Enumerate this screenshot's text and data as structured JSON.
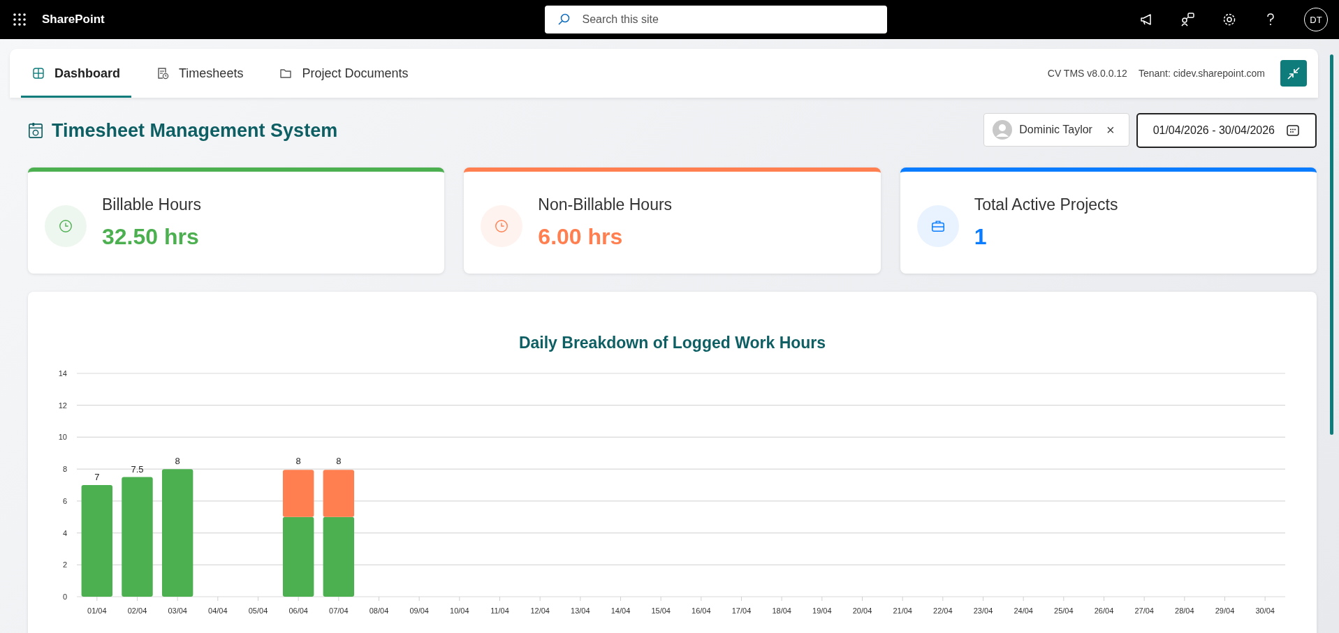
{
  "top_bar": {
    "app_name": "SharePoint",
    "search": {
      "placeholder": "Search this site"
    },
    "avatar_initials": "DT"
  },
  "tabs": [
    {
      "label": "Dashboard",
      "selected": true
    },
    {
      "label": "Timesheets",
      "selected": false
    },
    {
      "label": "Project Documents",
      "selected": false
    }
  ],
  "version": "CV TMS v8.0.0.12",
  "tenant": "Tenant: cidev.sharepoint.com",
  "page_title": "Timesheet Management System",
  "user_filter": {
    "name": "Dominic Taylor",
    "remove": "×"
  },
  "date_range": {
    "value": "01/04/2026 - 30/04/2026"
  },
  "cards": [
    {
      "kind": "clock",
      "label": "Billable Hours",
      "value": "32.50 hrs",
      "color": "#4caf50"
    },
    {
      "kind": "clock",
      "label": "Non-Billable Hours",
      "value": "6.00 hrs",
      "color": "#ff7f50"
    },
    {
      "kind": "briefcase",
      "label": "Total Active Projects",
      "value": "1",
      "color": "#0a7cff"
    }
  ],
  "chart_panel": {
    "chart_data": {
      "type": "bar",
      "title": "Daily Breakdown of Logged Work Hours",
      "stacked": true,
      "grid": true,
      "value_labels": [
        "7",
        "7.5",
        "8",
        null,
        null,
        "8",
        "8",
        null,
        null,
        null,
        null,
        null,
        null,
        null,
        null,
        null,
        null,
        null,
        null,
        null,
        null,
        null,
        null,
        null,
        null,
        null,
        null,
        null,
        null,
        null
      ],
      "categories": [
        "01/04",
        "02/04",
        "03/04",
        "04/04",
        "05/04",
        "06/04",
        "07/04",
        "08/04",
        "09/04",
        "10/04",
        "11/04",
        "12/04",
        "13/04",
        "14/04",
        "15/04",
        "16/04",
        "17/04",
        "18/04",
        "19/04",
        "20/04",
        "21/04",
        "22/04",
        "23/04",
        "24/04",
        "25/04",
        "26/04",
        "27/04",
        "28/04",
        "29/04",
        "30/04"
      ],
      "series": [
        {
          "color": "#4caf50",
          "values": [
            7,
            7.5,
            8,
            null,
            null,
            5,
            5,
            null,
            null,
            null,
            null,
            null,
            null,
            null,
            null,
            null,
            null,
            null,
            null,
            null,
            null,
            null,
            null,
            null,
            null,
            null,
            null,
            null,
            null,
            null
          ]
        },
        {
          "color": "#ff7f50",
          "values": [
            null,
            null,
            null,
            null,
            null,
            3,
            3,
            null,
            null,
            null,
            null,
            null,
            null,
            null,
            null,
            null,
            null,
            null,
            null,
            null,
            null,
            null,
            null,
            null,
            null,
            null,
            null,
            null,
            null,
            null
          ]
        }
      ],
      "ylim": [
        0,
        14
      ],
      "yticks": [
        0,
        2,
        4,
        6,
        8,
        10,
        12,
        14
      ]
    }
  }
}
